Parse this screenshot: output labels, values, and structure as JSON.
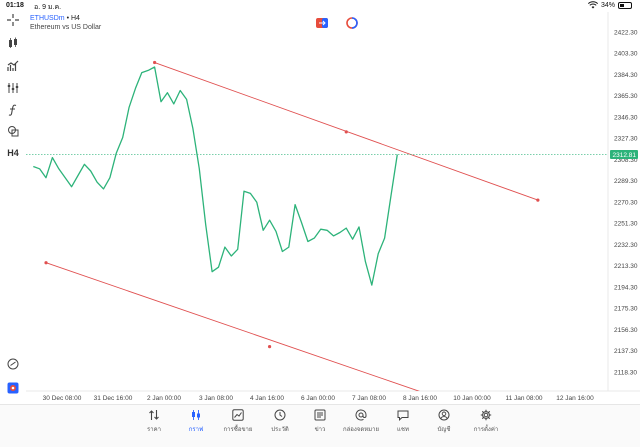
{
  "status": {
    "time": "01:18",
    "date": "อ. 9 ม.ค.",
    "battery": "34%",
    "battery_level": 0.34
  },
  "symbol": {
    "ticker": "ETHUSDm",
    "separator": " • ",
    "timeframe": "H4",
    "description": "Ethereum vs US Dollar"
  },
  "toolbar": {
    "timeframe_badge": "H4"
  },
  "icons": {
    "crosshair": "crosshair-icon",
    "cursor": "cursor-icon",
    "indicators": "indicators-icon",
    "objects": "objects-icon",
    "function": "function-icon",
    "shapes": "shapes-icon",
    "drawing_tools": "drawing-tools-icon",
    "settings": "settings-icon"
  },
  "colors": {
    "price_line": "#2db37a",
    "channel": "#e05050",
    "current_price_bg": "#2db37a",
    "accent": "#2962ff"
  },
  "price_axis": {
    "labels": [
      "2422.30",
      "2403.30",
      "2384.30",
      "2365.30",
      "2346.30",
      "2327.30",
      "2308.30",
      "2289.30",
      "2270.30",
      "2251.30",
      "2232.30",
      "2213.30",
      "2194.30",
      "2175.30",
      "2156.30",
      "2137.30",
      "2118.30"
    ],
    "current_price": "2312.81"
  },
  "time_axis": {
    "labels": [
      "30 Dec 08:00",
      "31 Dec 16:00",
      "2 Jan 00:00",
      "3 Jan 08:00",
      "4 Jan 16:00",
      "6 Jan 00:00",
      "7 Jan 08:00",
      "8 Jan 16:00",
      "10 Jan 00:00",
      "11 Jan 08:00",
      "12 Jan 16:00"
    ]
  },
  "chart_data": {
    "type": "line",
    "title": "",
    "xlabel": "",
    "ylabel": "",
    "ylim": [
      2110,
      2430
    ],
    "x": [
      "29 Dec 14:00",
      "29 Dec 18:00",
      "29 Dec 22:00",
      "30 Dec 02:00",
      "30 Dec 06:00",
      "30 Dec 10:00",
      "30 Dec 14:00",
      "30 Dec 18:00",
      "30 Dec 22:00",
      "31 Dec 02:00",
      "31 Dec 06:00",
      "31 Dec 10:00",
      "31 Dec 14:00",
      "31 Dec 18:00",
      "31 Dec 22:00",
      "1 Jan 02:00",
      "1 Jan 06:00",
      "1 Jan 10:00",
      "1 Jan 14:00",
      "1 Jan 18:00",
      "1 Jan 22:00",
      "2 Jan 02:00",
      "2 Jan 06:00",
      "2 Jan 10:00",
      "2 Jan 14:00",
      "2 Jan 18:00",
      "2 Jan 22:00",
      "3 Jan 02:00",
      "3 Jan 06:00",
      "3 Jan 10:00",
      "3 Jan 14:00",
      "3 Jan 18:00",
      "3 Jan 22:00",
      "4 Jan 02:00",
      "4 Jan 06:00",
      "4 Jan 10:00",
      "4 Jan 14:00",
      "4 Jan 18:00",
      "4 Jan 22:00",
      "5 Jan 02:00",
      "5 Jan 06:00",
      "5 Jan 10:00",
      "5 Jan 14:00",
      "5 Jan 18:00",
      "5 Jan 22:00",
      "6 Jan 02:00",
      "6 Jan 06:00",
      "6 Jan 10:00",
      "6 Jan 14:00",
      "6 Jan 18:00",
      "6 Jan 22:00",
      "7 Jan 02:00",
      "7 Jan 06:00",
      "7 Jan 10:00",
      "7 Jan 14:00",
      "7 Jan 18:00",
      "7 Jan 22:00",
      "8 Jan 02:00"
    ],
    "series": [
      {
        "values": [
          2302,
          2300,
          2292,
          2310,
          2300,
          2292,
          2284,
          2294,
          2304,
          2298,
          2288,
          2282,
          2292,
          2314,
          2328,
          2355,
          2372,
          2386,
          2388,
          2391,
          2360,
          2368,
          2358,
          2370,
          2362,
          2336,
          2300,
          2250,
          2208,
          2212,
          2230,
          2222,
          2228,
          2280,
          2278,
          2270,
          2245,
          2254,
          2244,
          2226,
          2230,
          2268,
          2252,
          2235,
          2238,
          2246,
          2245,
          2240,
          2243,
          2247,
          2237,
          2248,
          2217,
          2196,
          2224,
          2238,
          2276,
          2312.81
        ]
      }
    ],
    "channel_upper": {
      "x": [
        "1 Jan 18:00",
        "6 Jan 18:00",
        "11 Jan 18:00"
      ],
      "y": [
        2395,
        2333,
        2272
      ]
    },
    "channel_lower": {
      "x": [
        "29 Dec 22:00",
        "4 Jan 18:00",
        "8 Jan 22:00"
      ],
      "y": [
        2216,
        2141,
        2098
      ]
    },
    "current_price": 2312.81,
    "grid": false,
    "legend": "none"
  },
  "tabs": [
    {
      "label": "ราคา",
      "icon": "quotes-icon"
    },
    {
      "label": "กราฟ",
      "icon": "chart-icon",
      "active": true
    },
    {
      "label": "การซื้อขาย",
      "icon": "trade-icon"
    },
    {
      "label": "ประวัติ",
      "icon": "history-icon"
    },
    {
      "label": "ข่าว",
      "icon": "news-icon"
    },
    {
      "label": "กล่องจดหมาย",
      "icon": "mailbox-icon"
    },
    {
      "label": "แชท",
      "icon": "chat-icon"
    },
    {
      "label": "บัญชี",
      "icon": "account-icon"
    },
    {
      "label": "การตั้งค่า",
      "icon": "settings-icon"
    }
  ]
}
